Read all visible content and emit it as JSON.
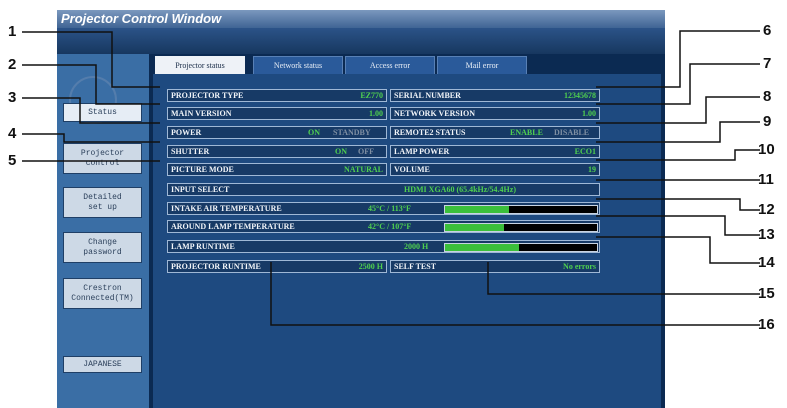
{
  "window": {
    "title": "Projector Control Window"
  },
  "sidebar": {
    "items": [
      {
        "label": "Status"
      },
      {
        "label": "Projector\ncontrol"
      },
      {
        "label": "Detailed\nset up"
      },
      {
        "label": "Change\npassword"
      },
      {
        "label": "Crestron\nConnected(TM)"
      },
      {
        "label": "JAPANESE"
      }
    ]
  },
  "tabs": [
    {
      "label": "Projector status"
    },
    {
      "label": "Network status"
    },
    {
      "label": "Access error"
    },
    {
      "label": "Mail error"
    }
  ],
  "status": {
    "projector_type": {
      "label": "PROJECTOR TYPE",
      "value": "EZ770"
    },
    "serial_number": {
      "label": "SERIAL NUMBER",
      "value": "12345678"
    },
    "main_version": {
      "label": "MAIN VERSION",
      "value": "1.00"
    },
    "network_version": {
      "label": "NETWORK VERSION",
      "value": "1.00"
    },
    "power": {
      "label": "POWER",
      "on": "ON",
      "off": "STANDBY"
    },
    "remote2": {
      "label": "REMOTE2 STATUS",
      "on": "ENABLE",
      "off": "DISABLE"
    },
    "shutter": {
      "label": "SHUTTER",
      "on": "ON",
      "off": "OFF"
    },
    "lamp_power": {
      "label": "LAMP POWER",
      "value": "ECO1"
    },
    "picture_mode": {
      "label": "PICTURE MODE",
      "value": "NATURAL"
    },
    "volume": {
      "label": "VOLUME",
      "value": "19"
    },
    "input_select": {
      "label": "INPUT SELECT",
      "value": "HDMI   XGA60 (65.4kHz/54.4Hz)"
    },
    "intake_temp": {
      "label": "INTAKE AIR TEMPERATURE",
      "value": "45°C / 113°F",
      "level": 0.42
    },
    "lamp_temp": {
      "label": "AROUND LAMP TEMPERATURE",
      "value": "42°C / 107°F",
      "level": 0.39
    },
    "lamp_runtime": {
      "label": "LAMP RUNTIME",
      "value": "2000 H",
      "level": 0.49
    },
    "projector_runtime": {
      "label": "PROJECTOR RUNTIME",
      "value": "2500 H"
    },
    "self_test": {
      "label": "SELF TEST",
      "value": "No errors"
    }
  },
  "callouts": [
    "1",
    "2",
    "3",
    "4",
    "5",
    "6",
    "7",
    "8",
    "9",
    "10",
    "11",
    "12",
    "13",
    "14",
    "15",
    "16"
  ]
}
